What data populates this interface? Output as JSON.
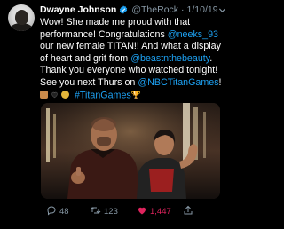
{
  "tweet": {
    "author_name": "Dwayne Johnson",
    "handle": "@TheRock",
    "separator": "·",
    "date": "1/10/19",
    "lines": [
      [
        {
          "t": "Wow! She made me proud with that"
        }
      ],
      [
        {
          "t": "performance! Congratulations "
        },
        {
          "t": "@neeks_93",
          "link": true
        }
      ],
      [
        {
          "t": "our new female TITAN!! And what a display"
        }
      ],
      [
        {
          "t": "of heart and grit from "
        },
        {
          "t": "@beastnthebeauty",
          "link": true
        },
        {
          "t": "."
        }
      ],
      [
        {
          "t": "Thank you everyone who watched tonight!"
        }
      ],
      [
        {
          "t": "See you next Thurs on "
        },
        {
          "t": "@NBCTitanGames",
          "link": true
        },
        {
          "t": "!"
        }
      ],
      [
        {
          "emoji": "flexed-biceps"
        },
        {
          "emoji": "black-heart"
        },
        {
          "emoji": "medal"
        },
        {
          "t": " "
        },
        {
          "t": "#TitanGames",
          "link": true
        },
        {
          "emoji": "trophy-icon-char"
        }
      ]
    ],
    "hashtag_symbol": "🏆"
  },
  "media": {
    "description_icon": "photo"
  },
  "actions": {
    "replies": "48",
    "retweets": "123",
    "likes": "1,447"
  },
  "colors": {
    "background": "#000000",
    "text": "#ffffff",
    "muted": "#8899a6",
    "link": "#1da1f2",
    "like": "#e0245e",
    "verified": "#1da1f2"
  }
}
